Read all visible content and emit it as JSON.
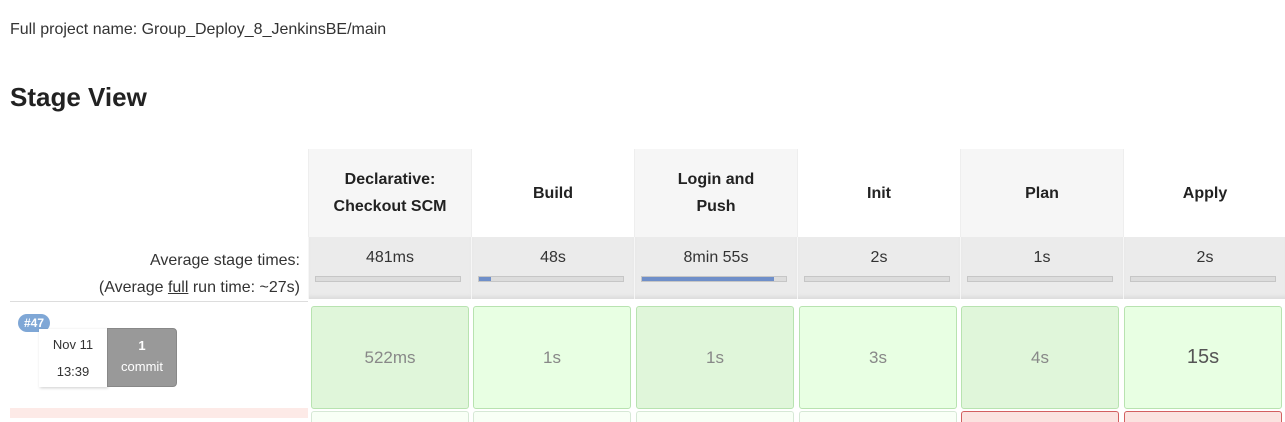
{
  "project": {
    "full_name_label": "Full project name: Group_Deploy_8_JenkinsBE/main"
  },
  "stage_view": {
    "title": "Stage View",
    "avg_stage_times_label": "Average stage times:",
    "avg_full_prefix": "(Average ",
    "avg_full_link": "full",
    "avg_full_suffix": " run time: ~27s)",
    "stages": [
      {
        "name_line1": "Declarative:",
        "name_line2": "Checkout SCM",
        "avg": "481ms",
        "progress": 0.0
      },
      {
        "name_line1": "Build",
        "name_line2": "",
        "avg": "48s",
        "progress": 0.08
      },
      {
        "name_line1": "Login and",
        "name_line2": "Push",
        "avg": "8min 55s",
        "progress": 0.92
      },
      {
        "name_line1": "Init",
        "name_line2": "",
        "avg": "2s",
        "progress": 0.0
      },
      {
        "name_line1": "Plan",
        "name_line2": "",
        "avg": "1s",
        "progress": 0.0
      },
      {
        "name_line1": "Apply",
        "name_line2": "",
        "avg": "2s",
        "progress": 0.0
      }
    ],
    "runs": [
      {
        "badge": "#47",
        "date": "Nov 11",
        "time": "13:39",
        "commit_count": "1",
        "commit_label": "commit",
        "stage_times": [
          "522ms",
          "1s",
          "1s",
          "3s",
          "4s",
          "15s"
        ]
      }
    ]
  },
  "colors": {
    "success_cell": "#e0f6da",
    "failed_border": "#d26060",
    "progress_fill": "#6f8fc9",
    "badge": "#7fa7d6"
  }
}
